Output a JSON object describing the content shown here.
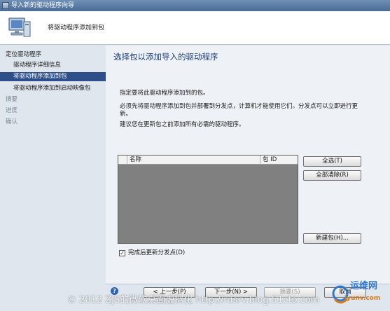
{
  "window": {
    "title": "导入新的驱动程序向导"
  },
  "header": {
    "subtitle": "将驱动程序添加到包"
  },
  "sidebar": {
    "items": [
      {
        "label": "定位驱动程序",
        "state": "normal"
      },
      {
        "label": "驱动程序详细信息",
        "state": "normal"
      },
      {
        "label": "将驱动程序添加到包",
        "state": "active"
      },
      {
        "label": "将驱动程序添加到启动映像包",
        "state": "normal"
      },
      {
        "label": "摘要",
        "state": "muted"
      },
      {
        "label": "进度",
        "state": "muted"
      },
      {
        "label": "确认",
        "state": "muted"
      }
    ]
  },
  "main": {
    "title": "选择包以添加导入的驱动程序",
    "instructions": [
      "指定要将此驱动程序添加到的包。",
      "必须先将驱动程序添加到包并部署到分发点，计算机才能使用它们。分发点可以立即进行更",
      "新。",
      "建议您在更新包之前添加所有必需的驱动程序。"
    ],
    "list": {
      "columns": [
        "名称",
        "包 ID"
      ],
      "rows": []
    },
    "buttons": {
      "select_all": "全选(T)",
      "clear_all": "全部清除(R)",
      "new_package": "新建包(H)..."
    },
    "checkbox": {
      "label": "完成后更新分发点(D)",
      "checked": true,
      "mark": "✓"
    }
  },
  "footer": {
    "help_glyph": "?",
    "prev": "< 上一步(P)",
    "next": "下一步(N) >",
    "summary": "摘要(S)",
    "cancel": "取消"
  },
  "watermark": {
    "text": "© 2012 ZJS的微软桌面虚拟化 http://rdsrv.blog.51cto.com"
  },
  "logo": {
    "name": "运维网",
    "domain": "iyunv.com"
  },
  "colors": {
    "accent": "#2e4f8a",
    "title_blue": "#1c3f7a",
    "list_bg": "#808080"
  }
}
